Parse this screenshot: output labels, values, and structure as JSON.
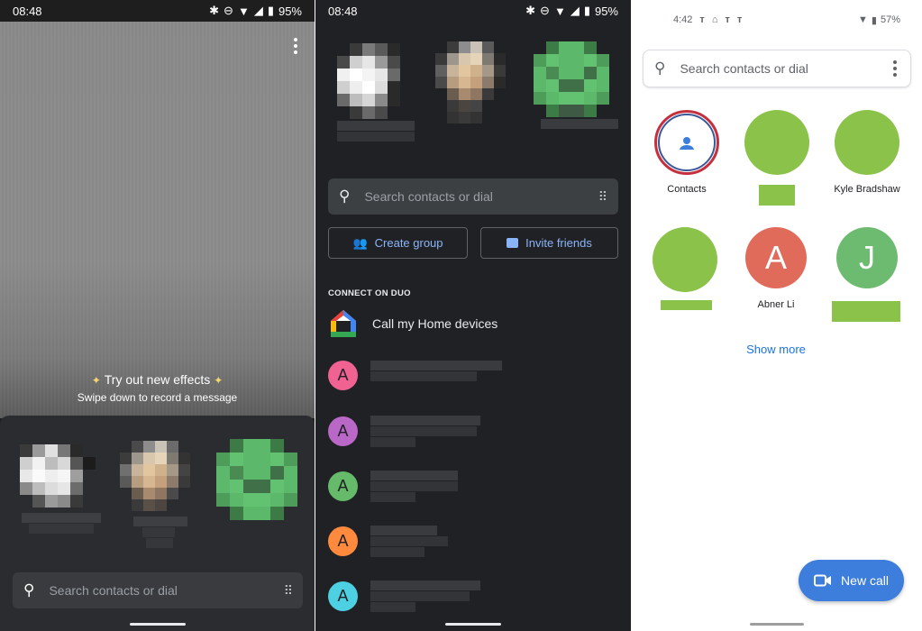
{
  "panel1": {
    "status": {
      "time": "08:48",
      "battery": "95%"
    },
    "effects_title": "Try out new effects",
    "effects_subtitle": "Swipe down to record a message",
    "search_placeholder": "Search contacts or dial"
  },
  "panel2": {
    "status": {
      "time": "08:48",
      "battery": "95%"
    },
    "search_placeholder": "Search contacts or dial",
    "create_group": "Create group",
    "invite_friends": "Invite friends",
    "section_title": "CONNECT ON DUO",
    "home_devices": "Call my Home devices",
    "contacts": [
      {
        "initial": "A",
        "color": "#f06292"
      },
      {
        "initial": "A",
        "color": "#ba68c8"
      },
      {
        "initial": "A",
        "color": "#66bb6a"
      },
      {
        "initial": "A",
        "color": "#ff8a3d"
      },
      {
        "initial": "A",
        "color": "#4dd0e1"
      }
    ]
  },
  "panel3": {
    "status": {
      "time": "4:42",
      "battery": "57%"
    },
    "search_placeholder": "Search contacts or dial",
    "tiles": [
      {
        "name": "Contacts",
        "kind": "contacts"
      },
      {
        "name": "",
        "kind": "green"
      },
      {
        "name": "Kyle Bradshaw",
        "kind": "green"
      },
      {
        "name": "",
        "kind": "green"
      },
      {
        "name": "Abner Li",
        "initial": "A",
        "color": "#e06b5b"
      },
      {
        "name": "",
        "initial": "J",
        "color": "#6dbb70"
      }
    ],
    "show_more": "Show more",
    "new_call": "New call"
  },
  "colors": {
    "accent_blue": "#8ab4f8",
    "fab_blue": "#3d7ddb",
    "contact_green": "#8bc34a"
  }
}
